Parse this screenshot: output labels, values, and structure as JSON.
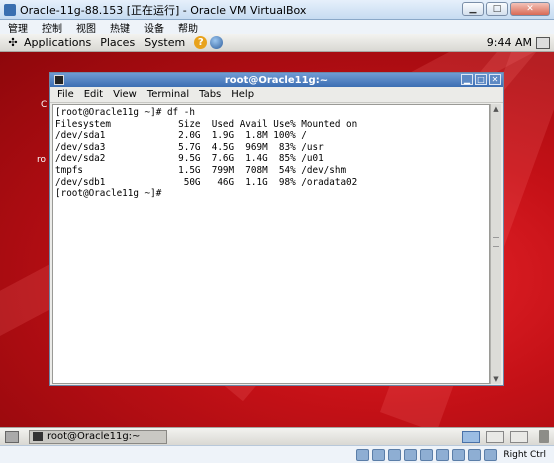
{
  "vbox": {
    "title": "Oracle-11g-88.153 [正在运行] - Oracle VM VirtualBox",
    "menu": [
      "管理",
      "控制",
      "视图",
      "热键",
      "设备",
      "帮助"
    ],
    "host_key": "Right Ctrl"
  },
  "top_panel": {
    "menus": [
      "Applications",
      "Places",
      "System"
    ],
    "clock": "9:44 AM"
  },
  "desktop": {
    "labels": [
      "C",
      "ro"
    ]
  },
  "terminal": {
    "title": "root@Oracle11g:~",
    "menu": [
      "File",
      "Edit",
      "View",
      "Terminal",
      "Tabs",
      "Help"
    ],
    "lines": [
      "[root@Oracle11g ~]# df -h",
      "Filesystem            Size  Used Avail Use% Mounted on",
      "/dev/sda1             2.0G  1.9G  1.8M 100% /",
      "/dev/sda3             5.7G  4.5G  969M  83% /usr",
      "/dev/sda2             9.5G  7.6G  1.4G  85% /u01",
      "tmpfs                 1.5G  799M  708M  54% /dev/shm",
      "/dev/sdb1              50G   46G  1.1G  98% /oradata02",
      "[root@Oracle11g ~]#"
    ]
  },
  "bottom_panel": {
    "task_label": "root@Oracle11g:~"
  }
}
